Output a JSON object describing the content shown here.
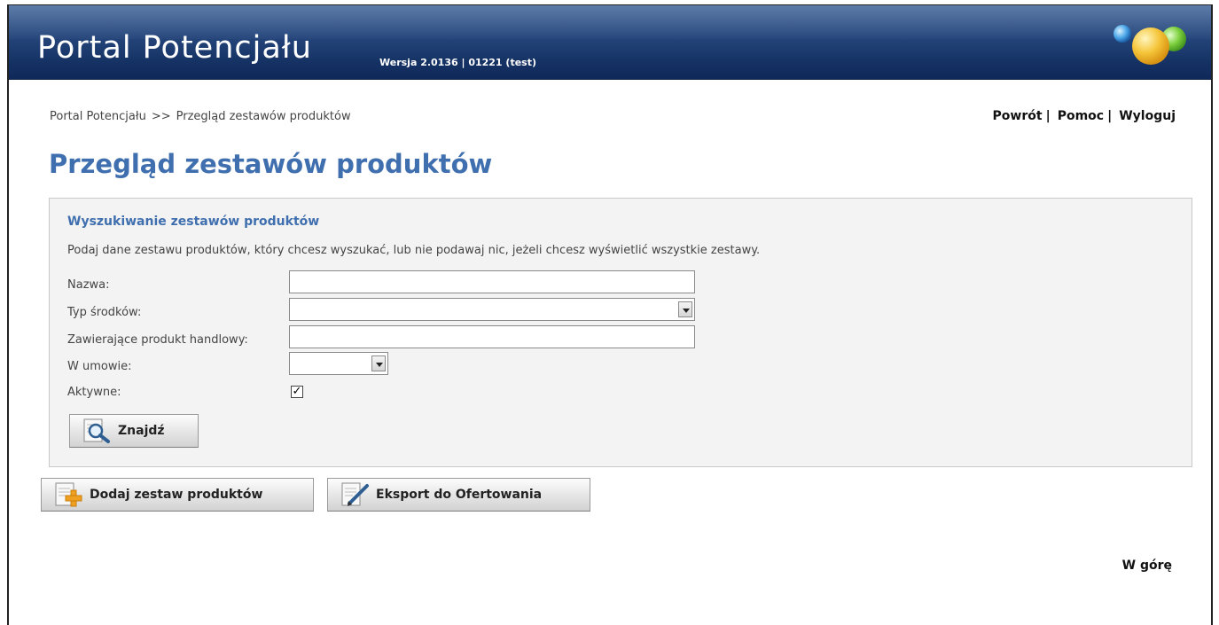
{
  "header": {
    "app_title": "Portal Potencjału",
    "version": "Wersja 2.0136 | 01221 (test)",
    "logo_icon": "colored-balls-logo"
  },
  "breadcrumb": {
    "home": "Portal Potencjału",
    "separator": ">>",
    "current": "Przegląd zestawów produktów"
  },
  "toplinks": {
    "back": "Powrót",
    "help": "Pomoc",
    "logout": "Wyloguj",
    "separator": "|"
  },
  "page": {
    "title": "Przegląd zestawów produktów"
  },
  "search": {
    "title": "Wyszukiwanie zestawów produktów",
    "description": "Podaj dane zestawu produktów, który chcesz wyszukać, lub nie podawaj nic, jeżeli chcesz wyświetlić wszystkie zestawy.",
    "fields": {
      "name_label": "Nazwa:",
      "name_value": "",
      "fund_type_label": "Typ środków:",
      "fund_type_value": "",
      "product_label": "Zawierające produkt handlowy:",
      "product_value": "",
      "contract_label": "W umowie:",
      "contract_value": "",
      "active_label": "Aktywne:",
      "active_checked": true
    },
    "find_button": "Znajdź",
    "find_icon": "magnifier-icon"
  },
  "actions": {
    "add_button": "Dodaj zestaw produktów",
    "add_icon": "document-add-icon",
    "export_button": "Eksport do Ofertowania",
    "export_icon": "document-edit-icon"
  },
  "footer": {
    "to_top": "W górę"
  },
  "colors": {
    "header_bg": "#1a3a6c",
    "title_blue": "#3f6fae",
    "panel_bg": "#f3f3f3"
  }
}
